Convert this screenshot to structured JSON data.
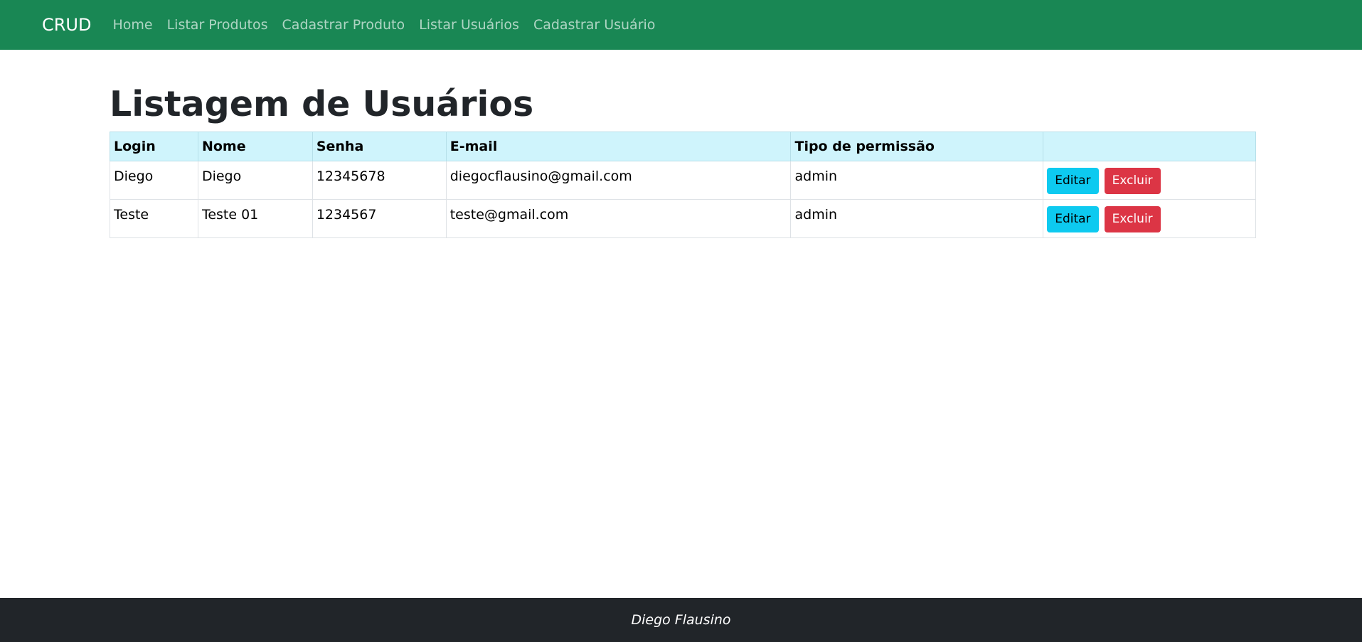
{
  "navbar": {
    "brand": "CRUD",
    "links": [
      {
        "label": "Home"
      },
      {
        "label": "Listar Produtos"
      },
      {
        "label": "Cadastrar Produto"
      },
      {
        "label": "Listar Usuários"
      },
      {
        "label": "Cadastrar Usuário"
      }
    ]
  },
  "main": {
    "title": "Listagem de Usuários",
    "table": {
      "columns": [
        "Login",
        "Nome",
        "Senha",
        "E-mail",
        "Tipo de permissão",
        ""
      ],
      "rows": [
        {
          "login": "Diego",
          "nome": "Diego",
          "senha": "12345678",
          "email": "diegocflausino@gmail.com",
          "permissao": "admin",
          "edit_label": "Editar",
          "delete_label": "Excluir"
        },
        {
          "login": "Teste",
          "nome": "Teste 01",
          "senha": "1234567",
          "email": "teste@gmail.com",
          "permissao": "admin",
          "edit_label": "Editar",
          "delete_label": "Excluir"
        }
      ]
    }
  },
  "footer": {
    "text": "Diego Flausino"
  },
  "colors": {
    "navbar_bg": "#198754",
    "table_header_bg": "#cff4fc",
    "edit_button": "#0dcaf0",
    "delete_button": "#dc3545",
    "footer_bg": "#212529"
  }
}
